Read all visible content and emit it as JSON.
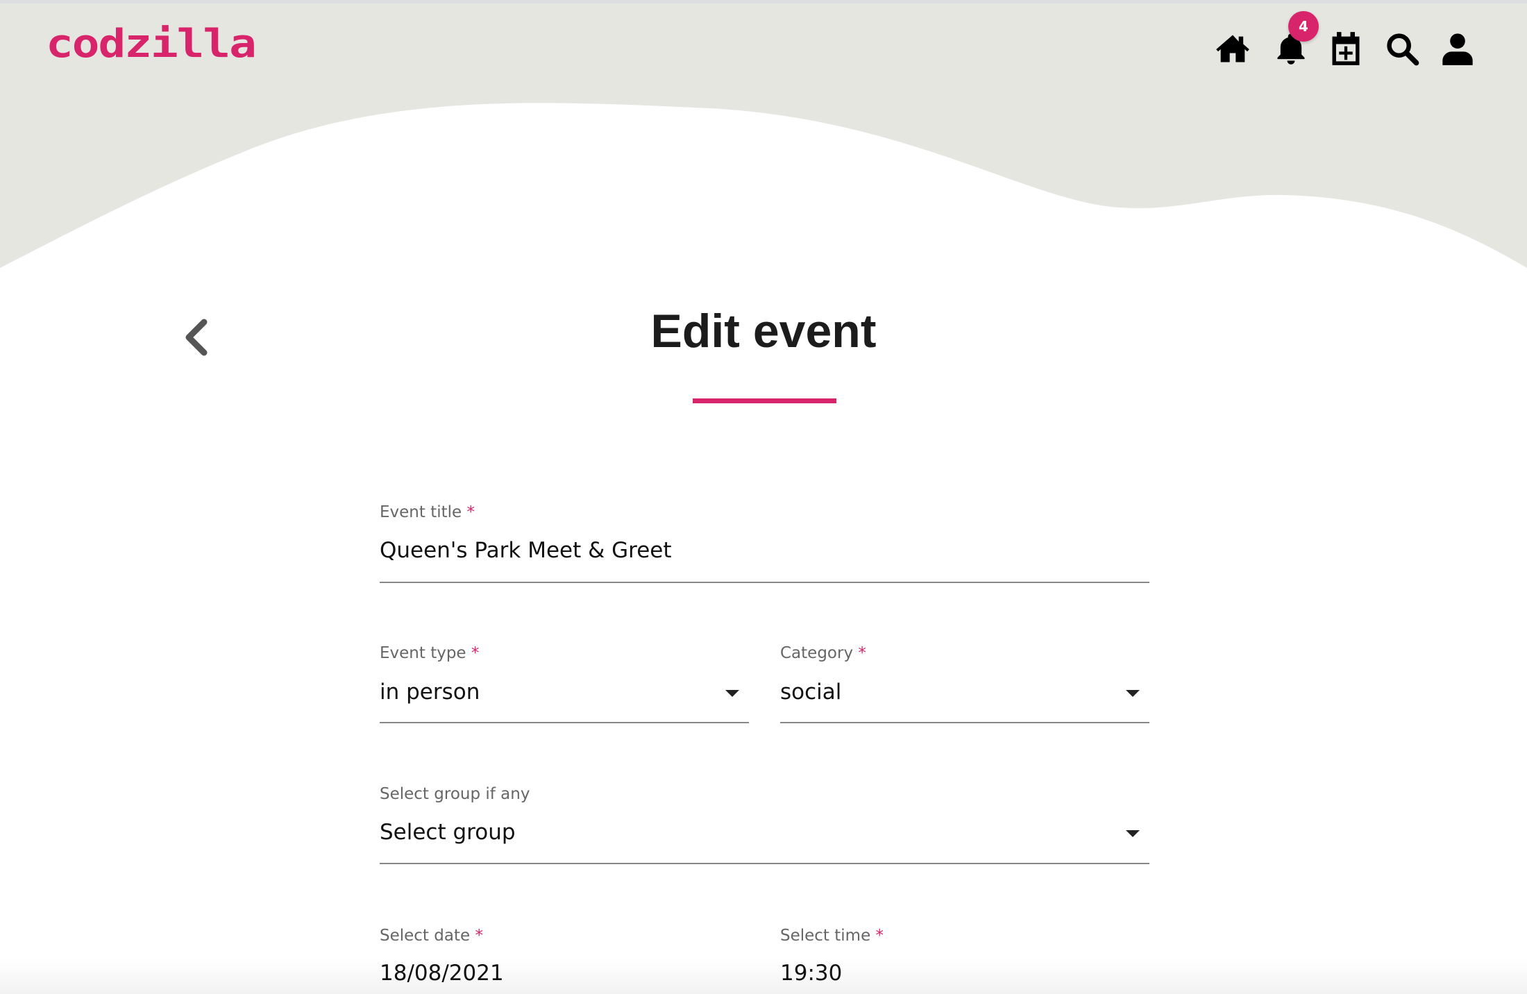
{
  "header": {
    "logo": "codzilla",
    "notification_count": "4",
    "icons": [
      "home-icon",
      "bell-icon",
      "calendar-plus-icon",
      "search-icon",
      "user-icon"
    ]
  },
  "page": {
    "title": "Edit event",
    "back_icon": "chevron-left-icon"
  },
  "form": {
    "event_title": {
      "label": "Event title",
      "required": "*",
      "value": "Queen's Park Meet & Greet"
    },
    "event_type": {
      "label": "Event type",
      "required": "*",
      "value": "in person"
    },
    "category": {
      "label": "Category",
      "required": "*",
      "value": "social"
    },
    "group": {
      "label": "Select group if any",
      "value": "Select group"
    },
    "date": {
      "label": "Select date",
      "required": "*",
      "value": "18/08/2021"
    },
    "time": {
      "label": "Select time",
      "required": "*",
      "value": "19:30"
    }
  },
  "colors": {
    "accent": "#d8246a",
    "header_bg": "#e6e6e1"
  }
}
